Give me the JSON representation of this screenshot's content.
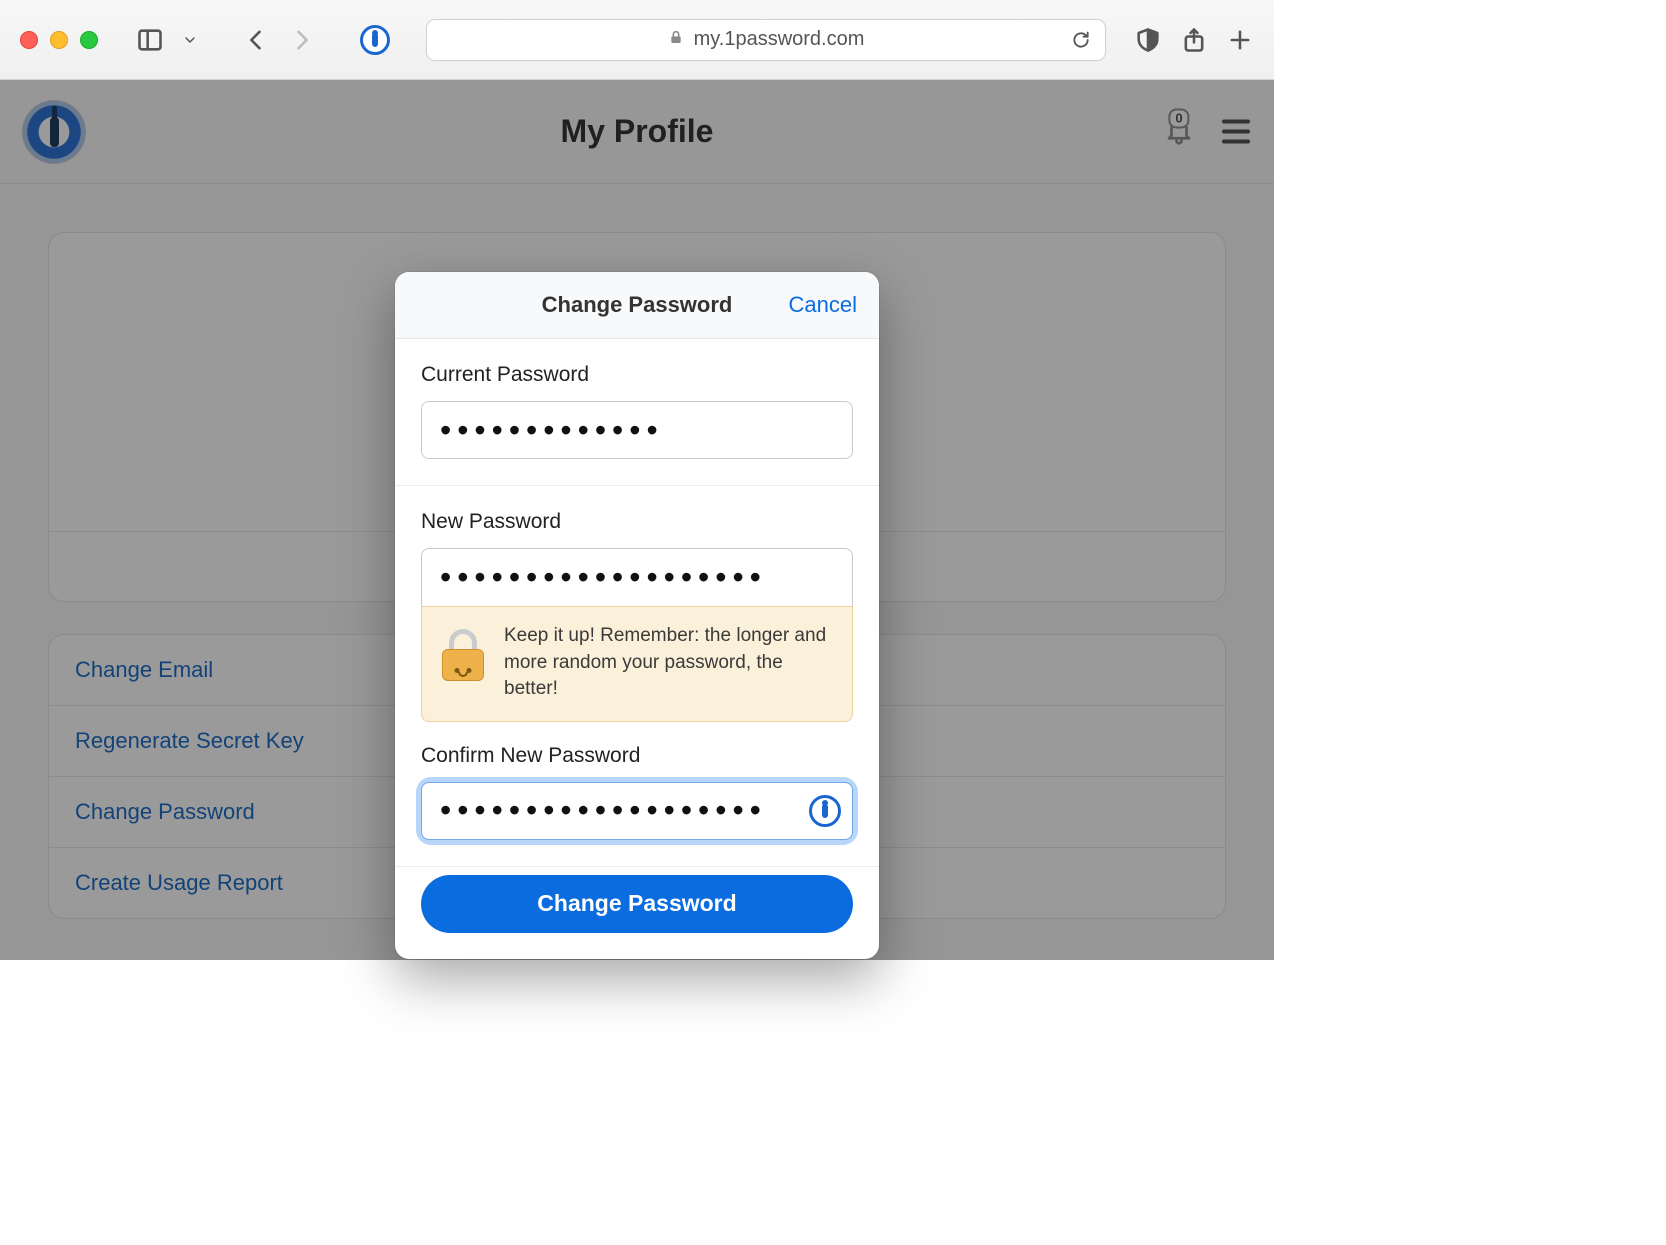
{
  "browser": {
    "url_host": "my.1password.com"
  },
  "page": {
    "title": "My Profile",
    "notification_count": "0",
    "actions": [
      "Change Email",
      "Regenerate Secret Key",
      "Change Password",
      "Create Usage Report"
    ]
  },
  "modal": {
    "title": "Change Password",
    "cancel": "Cancel",
    "current_label": "Current Password",
    "current_value": "•••••••••••••",
    "new_label": "New Password",
    "new_value": "•••••••••••••••••••",
    "hint": "Keep it up! Remember: the longer and more random your password, the better!",
    "confirm_label": "Confirm New Password",
    "confirm_value": "•••••••••••••••••••",
    "submit": "Change Password"
  }
}
